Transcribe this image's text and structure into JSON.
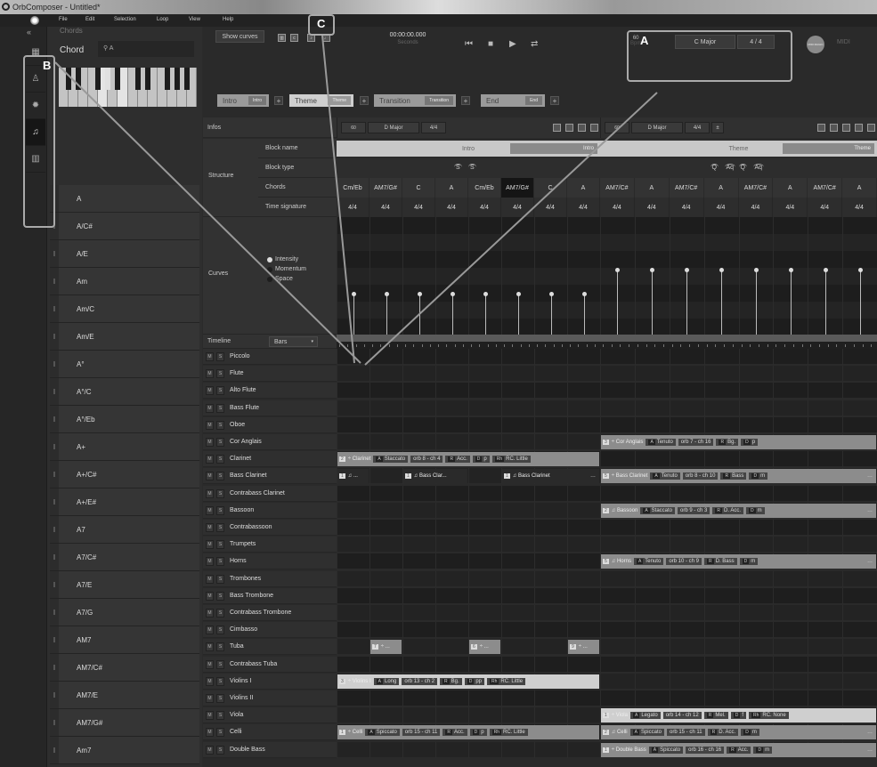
{
  "window": {
    "title": "OrbComposer - Untitled*"
  },
  "menu": [
    "File",
    "Edit",
    "Selection",
    "Loop",
    "View",
    "Help"
  ],
  "callouts": {
    "a": "A",
    "b": "B",
    "c": "C"
  },
  "sidebar": {
    "collapse_icon": "«",
    "nav": [
      {
        "icon": "grid-icon",
        "glyph": "▦"
      },
      {
        "icon": "hierarchy-icon",
        "glyph": "♙"
      },
      {
        "icon": "settings-icon",
        "glyph": "✹"
      },
      {
        "icon": "chord-icon",
        "glyph": "♫",
        "active": true
      },
      {
        "icon": "piano-icon",
        "glyph": "▥"
      }
    ]
  },
  "chords_panel": {
    "title": "Chords",
    "chord_label": "Chord",
    "search_value": "A",
    "items": [
      "A",
      "A/C#",
      "A/E",
      "Am",
      "Am/C",
      "Am/E",
      "A°",
      "A°/C",
      "A°/Eb",
      "A+",
      "A+/C#",
      "A+/E#",
      "A7",
      "A7/C#",
      "A7/E",
      "A7/G",
      "AM7",
      "AM7/C#",
      "AM7/E",
      "AM7/G#",
      "Am7"
    ]
  },
  "toolbar": {
    "show_curves": "Show curves",
    "time": "00:00:00.000",
    "time_unit": "Seconds",
    "bpm": "60",
    "bpm_unit": "Bpm",
    "key": "C Major",
    "meter": "4 / 4",
    "midi_button": "MIDI MAGIC",
    "midi_label": "MIDI"
  },
  "blocks": [
    {
      "name": "Intro",
      "tag": "Intro"
    },
    {
      "name": "Theme",
      "tag": "Theme"
    },
    {
      "name": "Transition",
      "tag": "Transition"
    },
    {
      "name": "End",
      "tag": "End"
    }
  ],
  "structure": {
    "infos_label": "Infos",
    "structure_label": "Structure",
    "curves_label": "Curves",
    "row_labels": [
      "Block name",
      "Block type",
      "Chords",
      "Time signature"
    ],
    "curve_options": [
      {
        "label": "Intensity",
        "selected": true
      },
      {
        "label": "Momentum",
        "selected": false
      },
      {
        "label": "Space",
        "selected": false
      }
    ],
    "timeline_label": "Timeline",
    "timeline_mode": "Bars"
  },
  "sections": [
    {
      "bpm": "60",
      "key": "D Major",
      "meter": "4/4",
      "block_name": "Intro",
      "block_tag": "Intro",
      "block_types": [
        "S",
        "S"
      ],
      "chords": [
        "Cm/Eb",
        "AM7/G#",
        "C",
        "A",
        "Cm/Eb",
        "AM7/G#",
        "C",
        "A"
      ],
      "selected_chord": 5,
      "time_sigs": [
        "4/4",
        "4/4",
        "4/4",
        "4/4",
        "4/4",
        "4/4",
        "4/4",
        "4/4"
      ],
      "intensity": [
        0.35,
        0.35,
        0.35,
        0.35,
        0.35,
        0.35,
        0.35,
        0.35
      ]
    },
    {
      "bpm": "60",
      "key": "D Major",
      "meter": "4/4",
      "block_name": "Theme",
      "block_tag": "Theme",
      "block_types": [
        "Q",
        "Aq",
        "Q",
        "Aq"
      ],
      "chords": [
        "AM7/C#",
        "A",
        "AM7/C#",
        "A",
        "AM7/C#",
        "A",
        "AM7/C#",
        "A"
      ],
      "time_sigs": [
        "4/4",
        "4/4",
        "4/4",
        "4/4",
        "4/4",
        "4/4",
        "4/4",
        "4/4"
      ],
      "intensity": [
        0.55,
        0.55,
        0.55,
        0.55,
        0.55,
        0.55,
        0.55,
        0.55
      ]
    }
  ],
  "tracks": [
    "Piccolo",
    "Flute",
    "Alto Flute",
    "Bass Flute",
    "Oboe",
    "Cor Anglais",
    "Clarinet",
    "Bass Clarinet",
    "Contrabass Clarinet",
    "Bassoon",
    "Contrabassoon",
    "Trumpets",
    "Horns",
    "Trombones",
    "Bass Trombone",
    "Contrabass Trombone",
    "Cimbasso",
    "Tuba",
    "Contrabass Tuba",
    "Violins I",
    "Violins II",
    "Viola",
    "Celli",
    "Double Bass"
  ],
  "mute_label": "M",
  "solo_label": "S",
  "clips": [
    {
      "track": 5,
      "section": 1,
      "start": 0,
      "len": 8,
      "style": "mid",
      "parts": [
        "3",
        "÷ Cor Anglais",
        "A|Tenuto",
        "orb 7 - ch 16",
        "R|Bg.",
        "D|p"
      ],
      "more": false
    },
    {
      "track": 6,
      "section": 0,
      "start": 0,
      "len": 8,
      "style": "mid",
      "parts": [
        "2",
        "÷ Clarinet",
        "A|Staccato",
        "orb 8 - ch 4",
        "R|Acc.",
        "D|p",
        "Rh|RC. Little"
      ],
      "more": false
    },
    {
      "track": 7,
      "section": 0,
      "start": 0,
      "len": 1,
      "style": "dark",
      "parts": [
        "1",
        "♫ ..."
      ],
      "more": false
    },
    {
      "track": 7,
      "section": 0,
      "start": 2,
      "len": 2,
      "style": "dark",
      "parts": [
        "1",
        "♫ Bass Clar..."
      ],
      "more": false
    },
    {
      "track": 7,
      "section": 0,
      "start": 5,
      "len": 3,
      "style": "dark",
      "parts": [
        "1",
        "♫ Bass Clarinet"
      ],
      "more": true
    },
    {
      "track": 7,
      "section": 1,
      "start": 0,
      "len": 8,
      "style": "mid",
      "parts": [
        "5",
        "÷ Bass Clarinet",
        "A|Tenuto",
        "orb 8 - ch 10",
        "R|Bass",
        "D|m"
      ],
      "more": true
    },
    {
      "track": 9,
      "section": 1,
      "start": 0,
      "len": 8,
      "style": "mid",
      "parts": [
        "2",
        "♫ Bassoon",
        "A|Staccato",
        "orb 9 - ch 3",
        "R|D. Acc.",
        "D|m"
      ],
      "more": true
    },
    {
      "track": 12,
      "section": 1,
      "start": 0,
      "len": 8,
      "style": "mid",
      "parts": [
        "5",
        "♫ Horns",
        "A|Tenuto",
        "orb 10 - ch 9",
        "R|D. Bass",
        "D|m"
      ],
      "more": true
    },
    {
      "track": 17,
      "section": 0,
      "start": 1,
      "len": 1,
      "style": "mid",
      "parts": [
        "7",
        "÷ ..."
      ],
      "more": false
    },
    {
      "track": 17,
      "section": 0,
      "start": 4,
      "len": 1,
      "style": "mid",
      "parts": [
        "6",
        "÷ ..."
      ],
      "more": false
    },
    {
      "track": 17,
      "section": 0,
      "start": 7,
      "len": 1,
      "style": "mid",
      "parts": [
        "9",
        "÷ ..."
      ],
      "more": false
    },
    {
      "track": 19,
      "section": 0,
      "start": 0,
      "len": 8,
      "style": "light",
      "parts": [
        "3",
        "÷ Violins I",
        "A|Long",
        "orb 13 - ch 2",
        "R|Bg.",
        "D|pp",
        "Rh|RC. Little"
      ],
      "more": false
    },
    {
      "track": 21,
      "section": 1,
      "start": 0,
      "len": 8,
      "style": "light",
      "parts": [
        "1",
        "÷ Viola",
        "A|Legato",
        "orb 14 - ch 12",
        "R|Mel.",
        "D|f",
        "Rh|RC. None"
      ],
      "more": false
    },
    {
      "track": 22,
      "section": 0,
      "start": 0,
      "len": 8,
      "style": "mid",
      "parts": [
        "1",
        "÷ Celli",
        "A|Spiccato",
        "orb 15 - ch 11",
        "R|Acc.",
        "D|p",
        "Rh|RC. Little"
      ],
      "more": false
    },
    {
      "track": 22,
      "section": 1,
      "start": 0,
      "len": 8,
      "style": "mid",
      "parts": [
        "2",
        "♫ Celli",
        "A|Spiccato",
        "orb 15 - ch 11",
        "R|D. Acc.",
        "D|m"
      ],
      "more": true
    },
    {
      "track": 23,
      "section": 1,
      "start": 0,
      "len": 8,
      "style": "mid",
      "parts": [
        "1",
        "÷ Double Bass",
        "A|Spiccato",
        "orb 16 - ch 16",
        "R|Acc.",
        "D|m"
      ],
      "more": true
    }
  ]
}
